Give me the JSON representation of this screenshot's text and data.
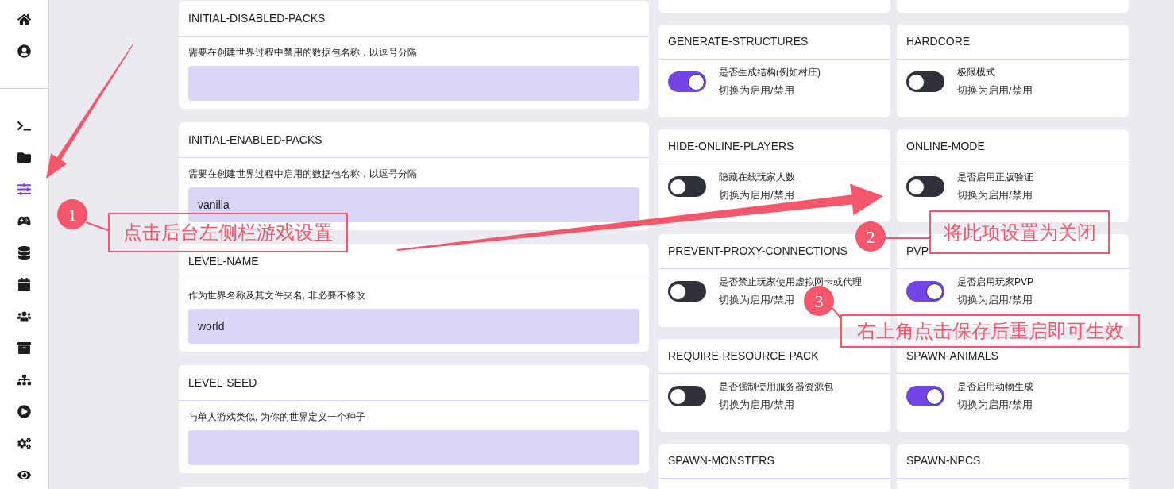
{
  "sidebar": {
    "groups": [
      [
        {
          "selected": false
        },
        {
          "selected": false
        }
      ],
      [
        {
          "selected": false
        },
        {
          "selected": false
        },
        {
          "selected": true
        },
        {
          "selected": false
        },
        {
          "selected": false
        },
        {
          "selected": false
        },
        {
          "selected": false
        },
        {
          "selected": false
        },
        {
          "selected": false
        },
        {
          "selected": false
        },
        {
          "selected": false
        },
        {
          "selected": false
        }
      ]
    ]
  },
  "text_settings": [
    {
      "title": "INITIAL-DISABLED-PACKS",
      "description": "需要在创建世界过程中禁用的数据包名称，以逗号分隔"
    },
    {
      "title": "INITIAL-ENABLED-PACKS",
      "description": "需要在创建世界过程中启用的数据包名称，以逗号分隔",
      "value": "vanilla"
    },
    {
      "title": "LEVEL-NAME",
      "description": "作为世界名称及其文件夹名, 非必要不修改",
      "value": "world"
    },
    {
      "title": "LEVEL-SEED",
      "description": "与单人游戏类似, 为你的世界定义一个种子"
    }
  ],
  "toggle_settings": [
    {
      "title": "GENERATE-STRUCTURES",
      "description": "是否生成结构(例如村庄)",
      "hint": "切换为启用/禁用",
      "on": true
    },
    {
      "title": "HARDCORE",
      "description": "极限模式",
      "hint": "切换为启用/禁用",
      "on": false
    },
    {
      "title": "HIDE-ONLINE-PLAYERS",
      "description": "隐藏在线玩家人数",
      "hint": "切换为启用/禁用",
      "on": false
    },
    {
      "title": "ONLINE-MODE",
      "description": "是否启用正版验证",
      "hint": "切换为启用/禁用",
      "on": false
    },
    {
      "title": "PREVENT-PROXY-CONNECTIONS",
      "description": "是否禁止玩家使用虚拟网卡或代理",
      "hint": "切换为启用/禁用",
      "on": false
    },
    {
      "title": "PVP",
      "description": "是否启用玩家PVP",
      "hint": "切换为启用/禁用",
      "on": true
    },
    {
      "title": "REQUIRE-RESOURCE-PACK",
      "description": "是否强制使用服务器资源包",
      "hint": "切换为启用/禁用",
      "on": false
    },
    {
      "title": "SPAWN-ANIMALS",
      "description": "是否启用动物生成",
      "hint": "切换为启用/禁用",
      "on": true
    },
    {
      "title": "SPAWN-MONSTERS"
    },
    {
      "title": "SPAWN-NPCS"
    }
  ],
  "annotations": [
    {
      "number": "1",
      "text": "点击后台左侧栏游戏设置"
    },
    {
      "number": "2",
      "text": "将此项设置为关闭"
    },
    {
      "number": "3",
      "text": "右上角点击保存后重启即可生效"
    }
  ]
}
